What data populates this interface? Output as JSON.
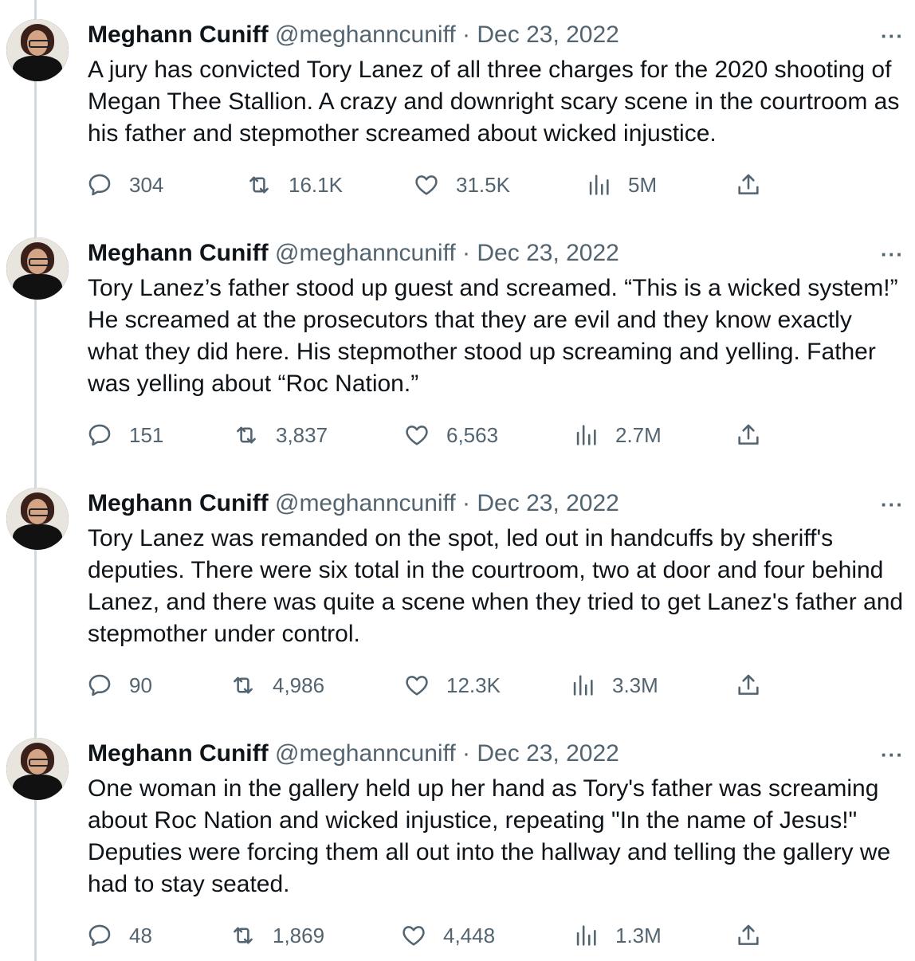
{
  "tweets": [
    {
      "name": "Meghann Cuniff",
      "handle": "@meghanncuniff",
      "separator": "·",
      "date": "Dec 23, 2022",
      "more": "···",
      "text": "A jury has convicted Tory Lanez of all three charges for the 2020 shooting of Megan Thee Stallion. A crazy and downright scary scene in the courtroom as his father and stepmother screamed about wicked injustice.",
      "replies": "304",
      "retweets": "16.1K",
      "likes": "31.5K",
      "views": "5M"
    },
    {
      "name": "Meghann Cuniff",
      "handle": "@meghanncuniff",
      "separator": "·",
      "date": "Dec 23, 2022",
      "more": "···",
      "text": "Tory Lanez’s father stood up guest and screamed. “This is a wicked system!” He screamed at the prosecutors that they are evil and they know exactly what they did here. His stepmother stood up screaming and yelling. Father was yelling about “Roc Nation.”",
      "replies": "151",
      "retweets": "3,837",
      "likes": "6,563",
      "views": "2.7M"
    },
    {
      "name": "Meghann Cuniff",
      "handle": "@meghanncuniff",
      "separator": "·",
      "date": "Dec 23, 2022",
      "more": "···",
      "text": "Tory Lanez was remanded on the spot, led out in handcuffs by sheriff's deputies. There were six total in the courtroom, two at door and four behind Lanez, and there was quite a scene when they tried to get Lanez's father and stepmother under control.",
      "replies": "90",
      "retweets": "4,986",
      "likes": "12.3K",
      "views": "3.3M"
    },
    {
      "name": "Meghann Cuniff",
      "handle": "@meghanncuniff",
      "separator": "·",
      "date": "Dec 23, 2022",
      "more": "···",
      "text": "One woman in the gallery held up her hand as Tory's father was screaming about Roc Nation and wicked injustice, repeating \"In the name of Jesus!\" Deputies were forcing them all out into the hallway and telling the gallery we had to stay seated.",
      "replies": "48",
      "retweets": "1,869",
      "likes": "4,448",
      "views": "1.3M"
    }
  ],
  "icons": {
    "reply": "reply-icon",
    "retweet": "retweet-icon",
    "like": "heart-icon",
    "views": "views-icon",
    "share": "share-icon"
  },
  "colors": {
    "text": "#0f1419",
    "secondary": "#536471",
    "thread_line": "#cfd9de"
  }
}
